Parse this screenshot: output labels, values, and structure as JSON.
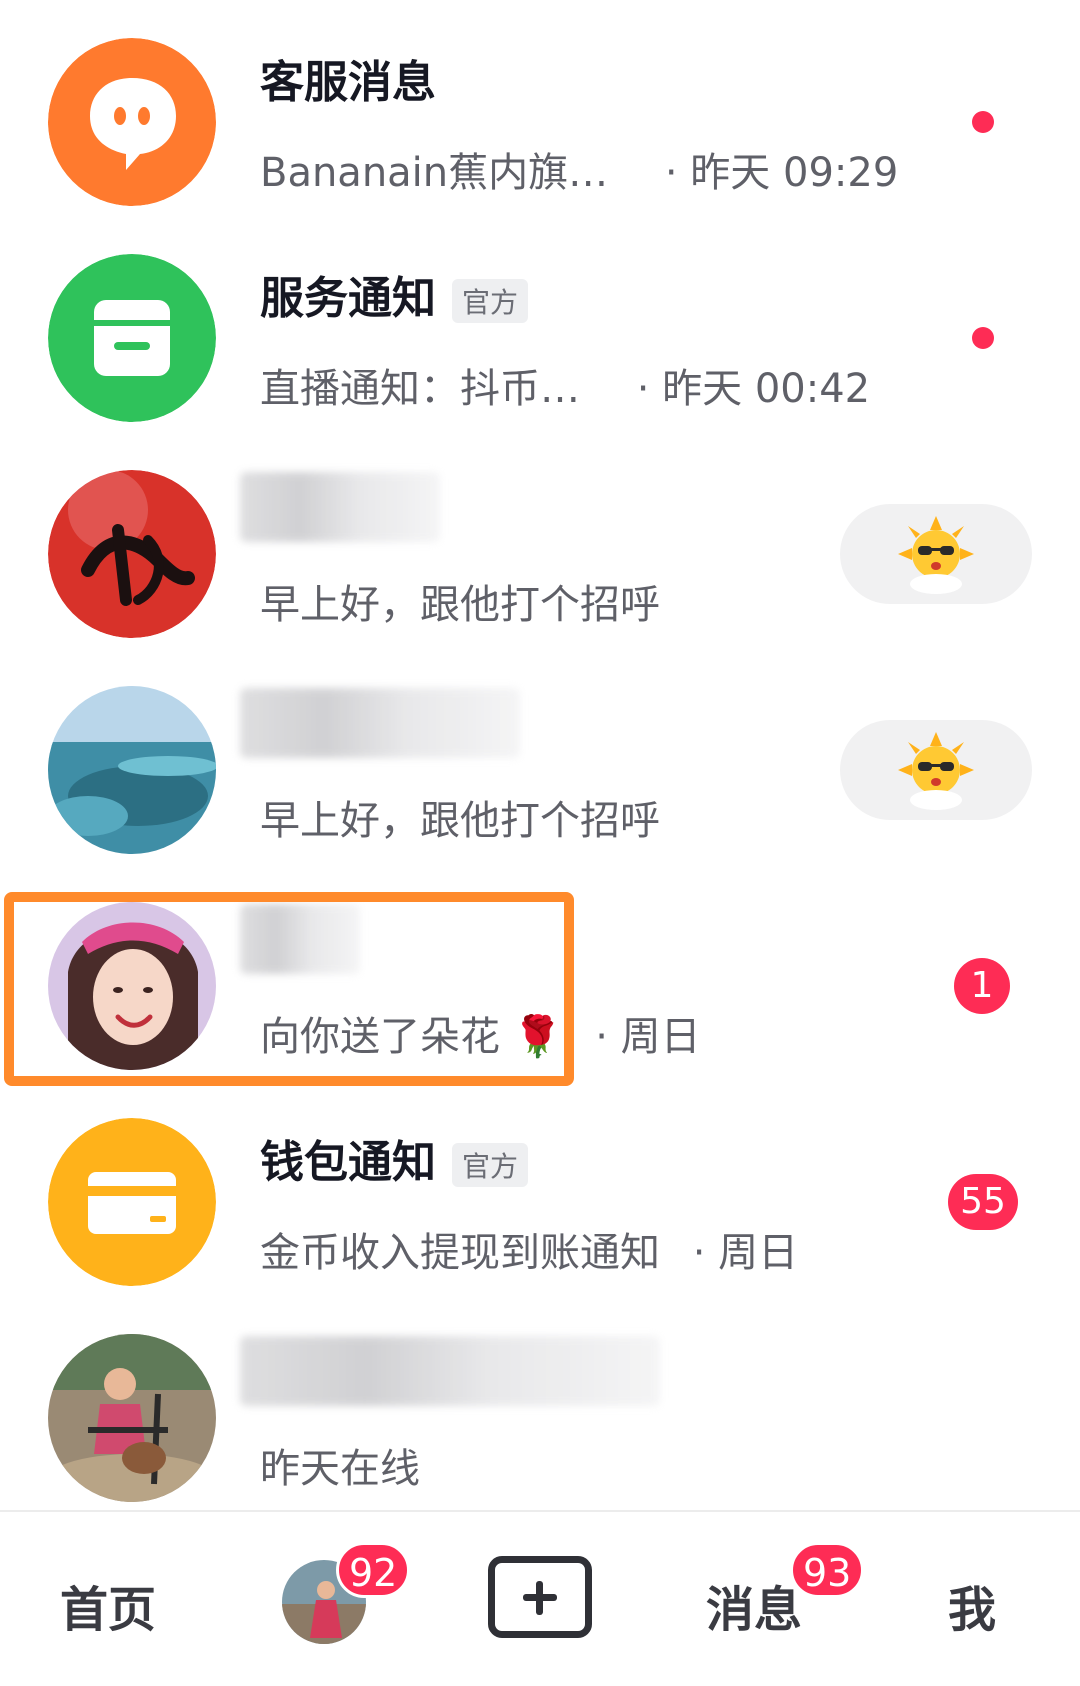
{
  "colors": {
    "accent": "#fe2c55",
    "highlight_box": "#ff8a2b",
    "service_orange": "#ff7a2e",
    "notify_green": "#2fc25b",
    "wallet_yellow": "#ffb21a"
  },
  "conversations": [
    {
      "name": "客服消息",
      "subtitle": "Bananain蕉内旗…",
      "time": "· 昨天 09:29",
      "icon": "chat-bubble-icon",
      "indicator": "dot"
    },
    {
      "name": "服务通知",
      "tag": "官方",
      "subtitle": "直播通知：抖币…",
      "time": "· 昨天 00:42",
      "icon": "inbox-tray-icon",
      "indicator": "dot"
    },
    {
      "name": "",
      "subtitle": "早上好，跟他打个招呼",
      "icon": "fu-character-avatar",
      "action": "sun-sunglasses-emoji-icon"
    },
    {
      "name": "",
      "subtitle": "早上好，跟他打个招呼",
      "icon": "sea-landscape-avatar",
      "action": "sun-sunglasses-emoji-icon"
    },
    {
      "name": "",
      "subtitle": "向你送了朵花",
      "emoji": "🌹",
      "time": "· 周日",
      "icon": "girl-portrait-avatar",
      "unread": "1"
    },
    {
      "name": "钱包通知",
      "tag": "官方",
      "subtitle": "金币收入提现到账通知",
      "time": "· 周日",
      "icon": "wallet-card-icon",
      "unread": "55"
    },
    {
      "name": "",
      "subtitle": "昨天在线",
      "icon": "outdoor-child-avatar"
    }
  ],
  "tabbar": {
    "home": "首页",
    "friends_badge": "92",
    "create_icon": "plus-icon",
    "messages": "消息",
    "messages_badge": "93",
    "me": "我"
  }
}
